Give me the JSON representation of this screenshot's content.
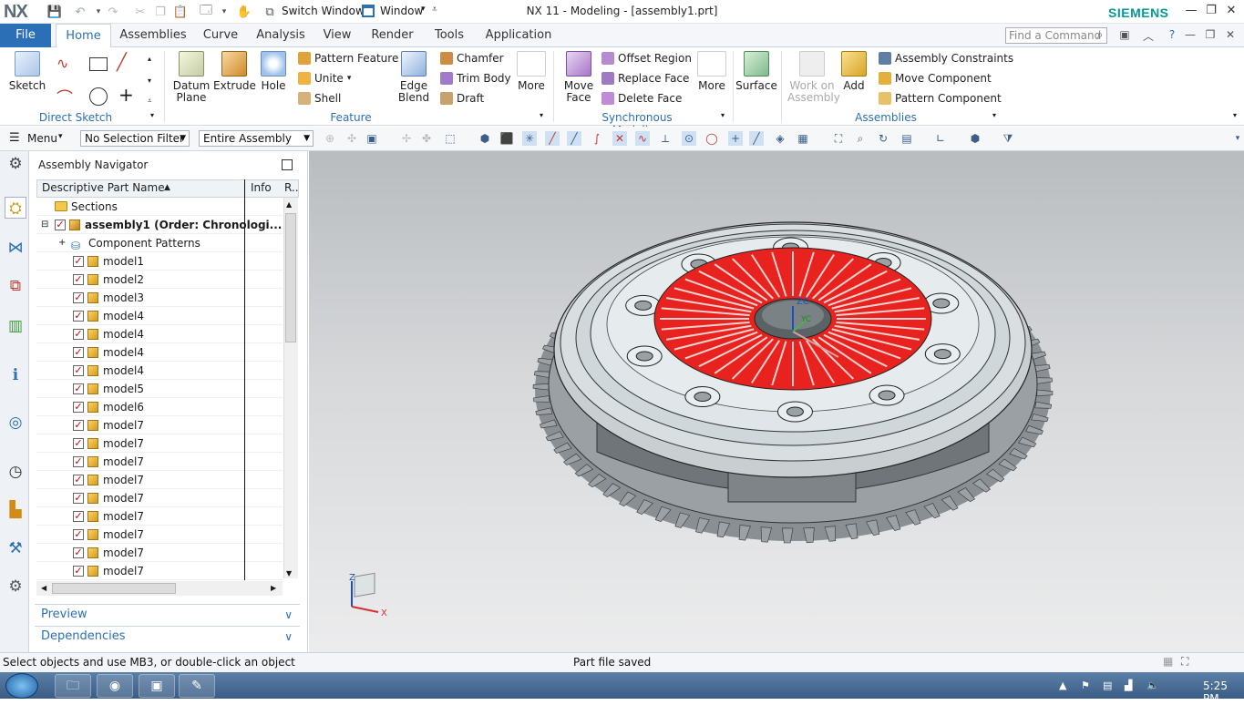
{
  "app": {
    "logo": "NX",
    "window_title": "NX 11 - Modeling - [assembly1.prt]",
    "brand": "SIEMENS",
    "switch_window": "Switch Window",
    "window_menu": "Window"
  },
  "tabs": {
    "file": "File",
    "items": [
      "Home",
      "Assemblies",
      "Curve",
      "Analysis",
      "View",
      "Render",
      "Tools",
      "Application"
    ],
    "active": "Home"
  },
  "find_command": {
    "placeholder": "Find a Command"
  },
  "ribbon": {
    "direct_sketch": {
      "sketch": "Sketch",
      "group": "Direct Sketch"
    },
    "feature": {
      "datum_plane": "Datum Plane",
      "extrude": "Extrude",
      "hole": "Hole",
      "pattern_feature": "Pattern Feature",
      "unite": "Unite",
      "shell": "Shell",
      "edge_blend": "Edge Blend",
      "chamfer": "Chamfer",
      "trim_body": "Trim Body",
      "draft": "Draft",
      "more": "More",
      "group": "Feature"
    },
    "sync": {
      "move_face": "Move Face",
      "offset_region": "Offset Region",
      "replace_face": "Replace Face",
      "delete_face": "Delete Face",
      "more": "More",
      "group": "Synchronous Modeling"
    },
    "surface": "Surface",
    "assemblies": {
      "work_on_assembly": "Work on Assembly",
      "add": "Add",
      "assembly_constraints": "Assembly Constraints",
      "move_component": "Move Component",
      "pattern_component": "Pattern Component",
      "group": "Assemblies"
    }
  },
  "toolbar": {
    "menu": "Menu",
    "selection_filter": "No Selection Filter",
    "scope": "Entire Assembly"
  },
  "navigator": {
    "title": "Assembly Navigator",
    "columns": [
      "Descriptive Part Name",
      "Info",
      "R.."
    ],
    "rows": [
      {
        "label": "Sections",
        "type": "folder"
      },
      {
        "label": "assembly1 (Order: Chronologi...",
        "type": "root"
      },
      {
        "label": "Component Patterns",
        "type": "patterns"
      },
      {
        "label": "model1",
        "type": "part"
      },
      {
        "label": "model2",
        "type": "part"
      },
      {
        "label": "model3",
        "type": "part"
      },
      {
        "label": "model4",
        "type": "part"
      },
      {
        "label": "model4",
        "type": "part"
      },
      {
        "label": "model4",
        "type": "part"
      },
      {
        "label": "model4",
        "type": "part"
      },
      {
        "label": "model5",
        "type": "part"
      },
      {
        "label": "model6",
        "type": "part"
      },
      {
        "label": "model7",
        "type": "part"
      },
      {
        "label": "model7",
        "type": "part"
      },
      {
        "label": "model7",
        "type": "part"
      },
      {
        "label": "model7",
        "type": "part"
      },
      {
        "label": "model7",
        "type": "part"
      },
      {
        "label": "model7",
        "type": "part"
      },
      {
        "label": "model7",
        "type": "part"
      },
      {
        "label": "model7",
        "type": "part"
      },
      {
        "label": "model7",
        "type": "part"
      }
    ],
    "preview": "Preview",
    "dependencies": "Dependencies"
  },
  "viewport": {
    "axis_labels": {
      "zc": "ZC",
      "yc": "YC",
      "z": "Z",
      "x": "X"
    }
  },
  "status": {
    "left": "Select objects and use MB3, or double-click an object",
    "center": "Part file saved"
  },
  "taskbar": {
    "clock": "5:25 PM"
  },
  "colors": {
    "accent": "#2b6fb6",
    "brand": "#009999",
    "friction": "#e8231f"
  }
}
